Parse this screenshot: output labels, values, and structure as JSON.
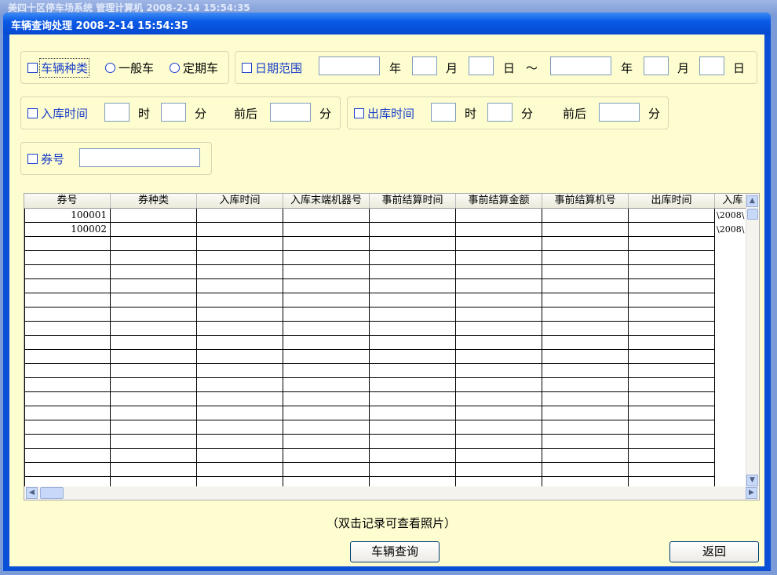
{
  "background_title": "美四十区停车场系统  管理计算机  2008-2-14  15:54:35",
  "window": {
    "title": "车辆查询处理 2008-2-14 15:54:35"
  },
  "filters": {
    "vehicle_type": {
      "label": "车辆种类",
      "options": [
        "一般车",
        "定期车"
      ]
    },
    "date_range": {
      "label": "日期范围",
      "year": "年",
      "month": "月",
      "day": "日",
      "sep": "～"
    },
    "entry_time": {
      "label": "入库时间",
      "hour": "时",
      "minute": "分",
      "around": "前后",
      "minute2": "分"
    },
    "exit_time": {
      "label": "出库时间",
      "hour": "时",
      "minute": "分",
      "around": "前后",
      "minute2": "分"
    },
    "ticket_no": {
      "label": "券号"
    }
  },
  "table": {
    "headers": [
      "券号",
      "券种类",
      "入库时间",
      "入库末端机器号",
      "事前结算时间",
      "事前结算金额",
      "事前结算机号",
      "出库时间",
      "入库"
    ],
    "rows": [
      [
        "100001",
        "",
        "",
        "",
        "",
        "",
        "",
        "",
        "\\2008\\"
      ],
      [
        "100002",
        "",
        "",
        "",
        "",
        "",
        "",
        "",
        "\\2008\\"
      ]
    ],
    "empty_rows": 18
  },
  "hint": "（双击记录可查看照片）",
  "buttons": {
    "query": "车辆查询",
    "back": "返回"
  },
  "colors": {
    "label_blue": "#1a3fc8",
    "client_bg": "#fefdd0",
    "title_blue": "#0a5ae6"
  }
}
